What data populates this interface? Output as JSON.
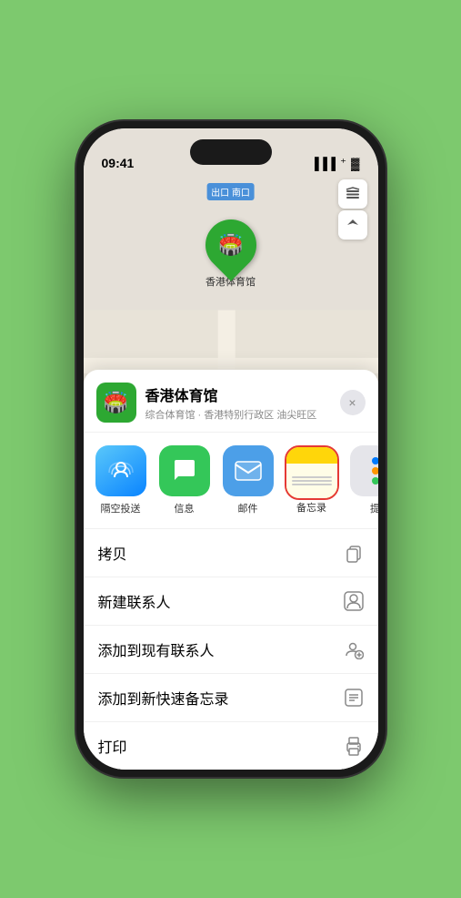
{
  "status_bar": {
    "time": "09:41",
    "location_arrow": "▶"
  },
  "map": {
    "label": "南口",
    "label_prefix": "出口"
  },
  "venue": {
    "name": "香港体育馆",
    "subtitle": "综合体育馆 · 香港特别行政区 油尖旺区",
    "icon": "🏟️"
  },
  "share_items": [
    {
      "id": "airdrop",
      "label": "隔空投送",
      "icon": "📡"
    },
    {
      "id": "messages",
      "label": "信息",
      "icon": "💬"
    },
    {
      "id": "mail",
      "label": "邮件",
      "icon": "✉️"
    },
    {
      "id": "notes",
      "label": "备忘录",
      "icon": ""
    },
    {
      "id": "more",
      "label": "提",
      "icon": "⠿"
    }
  ],
  "actions": [
    {
      "id": "copy",
      "label": "拷贝",
      "icon": "⎘"
    },
    {
      "id": "new-contact",
      "label": "新建联系人",
      "icon": "👤"
    },
    {
      "id": "add-to-contact",
      "label": "添加到现有联系人",
      "icon": "👤+"
    },
    {
      "id": "add-to-notes",
      "label": "添加到新快速备忘录",
      "icon": "□"
    },
    {
      "id": "print",
      "label": "打印",
      "icon": "🖨"
    }
  ],
  "buttons": {
    "close": "×",
    "map_layers": "🗺",
    "location": "➤"
  }
}
